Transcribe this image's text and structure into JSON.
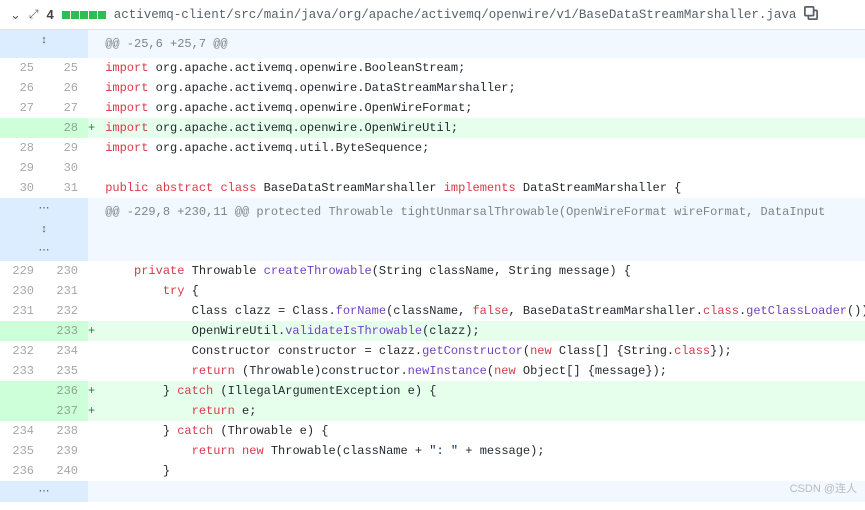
{
  "header": {
    "count": "4",
    "path": "activemq-client/src/main/java/org/apache/activemq/openwire/v1/BaseDataStreamMarshaller.java",
    "squares_color": "#2cbe4e"
  },
  "hunks": [
    {
      "type": "hunk",
      "text": "@@ -25,6 +25,7 @@"
    },
    {
      "type": "ctx",
      "old": "25",
      "new": "25",
      "html": "<span class='kw'>import</span> org.apache.activemq.openwire.BooleanStream;"
    },
    {
      "type": "ctx",
      "old": "26",
      "new": "26",
      "html": "<span class='kw'>import</span> org.apache.activemq.openwire.DataStreamMarshaller;"
    },
    {
      "type": "ctx",
      "old": "27",
      "new": "27",
      "html": "<span class='kw'>import</span> org.apache.activemq.openwire.OpenWireFormat;"
    },
    {
      "type": "add",
      "old": "",
      "new": "28",
      "html": "<span class='kw'>import</span> org.apache.activemq.openwire.OpenWireUtil;"
    },
    {
      "type": "ctx",
      "old": "28",
      "new": "29",
      "html": "<span class='kw'>import</span> org.apache.activemq.util.ByteSequence;"
    },
    {
      "type": "ctx",
      "old": "29",
      "new": "30",
      "html": ""
    },
    {
      "type": "ctx",
      "old": "30",
      "new": "31",
      "html": "<span class='kw'>public</span> <span class='kw'>abstract</span> <span class='kw'>class</span> <span class='cls'>BaseDataStreamMarshaller</span> <span class='kw'>implements</span> <span class='cls'>DataStreamMarshaller</span> {"
    },
    {
      "type": "hunk",
      "text": "@@ -229,8 +230,11 @@ protected Throwable tightUnmarsalThrowable(OpenWireFormat wireFormat, DataInput"
    },
    {
      "type": "ctx",
      "old": "229",
      "new": "230",
      "html": "    <span class='kw'>private</span> Throwable <span class='fn'>createThrowable</span>(String className, String message) {"
    },
    {
      "type": "ctx",
      "old": "230",
      "new": "231",
      "html": "        <span class='kw'>try</span> {"
    },
    {
      "type": "ctx",
      "old": "231",
      "new": "232",
      "html": "            Class clazz = Class.<span class='fn'>forName</span>(className, <span class='kw'>false</span>, BaseDataStreamMarshaller.<span class='kw'>class</span>.<span class='fn'>getClassLoader</span>());"
    },
    {
      "type": "add",
      "old": "",
      "new": "233",
      "html": "            OpenWireUtil.<span class='fn'>validateIsThrowable</span>(clazz);"
    },
    {
      "type": "ctx",
      "old": "232",
      "new": "234",
      "html": "            Constructor constructor = clazz.<span class='fn'>getConstructor</span>(<span class='kw'>new</span> Class[] {String.<span class='kw'>class</span>});"
    },
    {
      "type": "ctx",
      "old": "233",
      "new": "235",
      "html": "            <span class='kw'>return</span> (Throwable)constructor.<span class='fn'>newInstance</span>(<span class='kw'>new</span> Object[] {message});"
    },
    {
      "type": "add",
      "old": "",
      "new": "236",
      "html": "        } <span class='kw'>catch</span> (IllegalArgumentException e) {"
    },
    {
      "type": "add",
      "old": "",
      "new": "237",
      "html": "            <span class='kw'>return</span> e;"
    },
    {
      "type": "ctx",
      "old": "234",
      "new": "238",
      "html": "        } <span class='kw'>catch</span> (Throwable e) {"
    },
    {
      "type": "ctx",
      "old": "235",
      "new": "239",
      "html": "            <span class='kw'>return</span> <span class='kw'>new</span> Throwable(className + <span class='str'>\": \"</span> + message);"
    },
    {
      "type": "ctx",
      "old": "236",
      "new": "240",
      "html": "        }"
    }
  ],
  "markers": {
    "add": "+"
  },
  "expand_icons": {
    "up": "↕",
    "both": "⋯↕⋯",
    "down": "⋯"
  },
  "watermark": "CSDN @连人"
}
